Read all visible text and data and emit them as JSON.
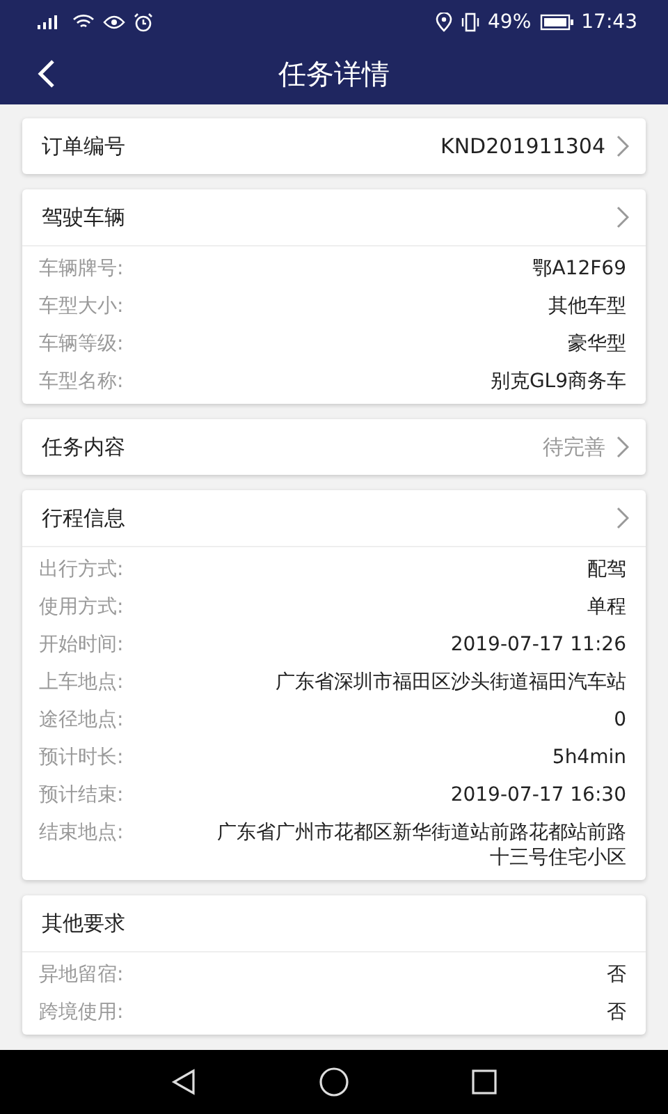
{
  "status_bar": {
    "battery": "49%",
    "time": "17:43"
  },
  "header": {
    "title": "任务详情"
  },
  "sections": [
    {
      "kind": "link",
      "title": "订单编号",
      "value": "KND201911304",
      "muted": false,
      "has_arrow": true
    },
    {
      "kind": "detail",
      "title": "驾驶车辆",
      "has_arrow": true,
      "rows": [
        {
          "label": "车辆牌号:",
          "value": "鄂A12F69"
        },
        {
          "label": "车型大小:",
          "value": "其他车型"
        },
        {
          "label": "车辆等级:",
          "value": "豪华型"
        },
        {
          "label": "车型名称:",
          "value": "别克GL9商务车"
        }
      ]
    },
    {
      "kind": "link",
      "title": "任务内容",
      "value": "待完善",
      "muted": true,
      "has_arrow": true
    },
    {
      "kind": "detail",
      "title": "行程信息",
      "has_arrow": true,
      "rows": [
        {
          "label": "出行方式:",
          "value": "配驾"
        },
        {
          "label": "使用方式:",
          "value": "单程"
        },
        {
          "label": "开始时间:",
          "value": "2019-07-17 11:26"
        },
        {
          "label": "上车地点:",
          "value": "广东省深圳市福田区沙头街道福田汽车站"
        },
        {
          "label": "途径地点:",
          "value": "0"
        },
        {
          "label": "预计时长:",
          "value": "5h4min"
        },
        {
          "label": "预计结束:",
          "value": "2019-07-17 16:30"
        },
        {
          "label": "结束地点:",
          "value": "广东省广州市花都区新华街道站前路花都站前路十三号住宅小区"
        }
      ]
    },
    {
      "kind": "detail",
      "title": "其他要求",
      "has_arrow": false,
      "rows": [
        {
          "label": "异地留宿:",
          "value": "否"
        },
        {
          "label": "跨境使用:",
          "value": "否"
        }
      ]
    }
  ]
}
